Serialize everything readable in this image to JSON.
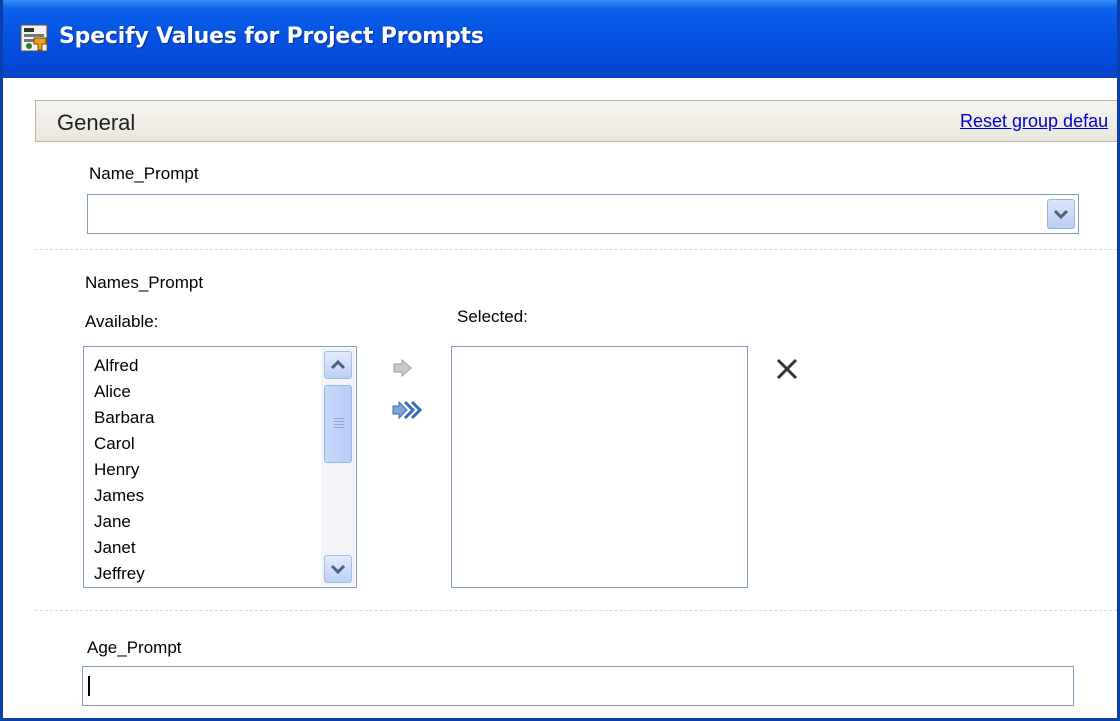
{
  "window": {
    "title": "Specify Values for Project Prompts",
    "icon": "prompt-wizard-icon"
  },
  "group": {
    "title": "General",
    "reset_link": "Reset group defau"
  },
  "name_prompt": {
    "label": "Name_Prompt",
    "value": ""
  },
  "names_prompt": {
    "label": "Names_Prompt",
    "available_label": "Available:",
    "selected_label": "Selected:",
    "available_items": [
      "Alfred",
      "Alice",
      "Barbara",
      "Carol",
      "Henry",
      "James",
      "Jane",
      "Janet",
      "Jeffrey"
    ],
    "selected_items": []
  },
  "age_prompt": {
    "label": "Age_Prompt",
    "value": ""
  },
  "icons": {
    "add": "arrow-right-icon",
    "add_all": "double-arrow-right-icon",
    "remove": "close-x-icon",
    "dropdown": "chevron-down-icon",
    "scroll_up": "chevron-up-icon",
    "scroll_down": "chevron-down-icon"
  },
  "colors": {
    "titlebar": "#0553e3",
    "link": "#0000cc",
    "field_border": "#7f9db9"
  }
}
